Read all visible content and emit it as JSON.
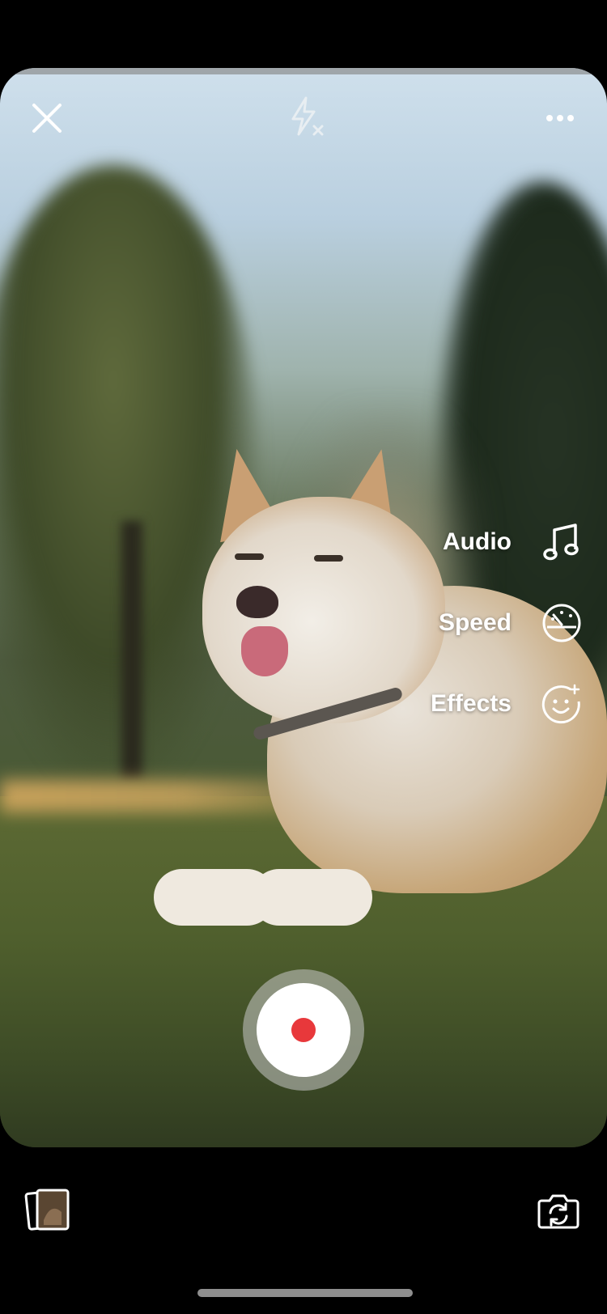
{
  "top_bar": {
    "close_icon": "close-icon",
    "flash_icon": "flash-off-icon",
    "more_icon": "more-horizontal-icon"
  },
  "side_menu": {
    "items": [
      {
        "label": "Audio",
        "icon": "music-note-icon"
      },
      {
        "label": "Speed",
        "icon": "speedometer-icon"
      },
      {
        "label": "Effects",
        "icon": "smiley-sparkle-icon"
      }
    ]
  },
  "record": {
    "dot_color": "#E8383B"
  },
  "bottom_bar": {
    "gallery_icon": "gallery-stack-icon",
    "flip_icon": "camera-flip-icon"
  }
}
